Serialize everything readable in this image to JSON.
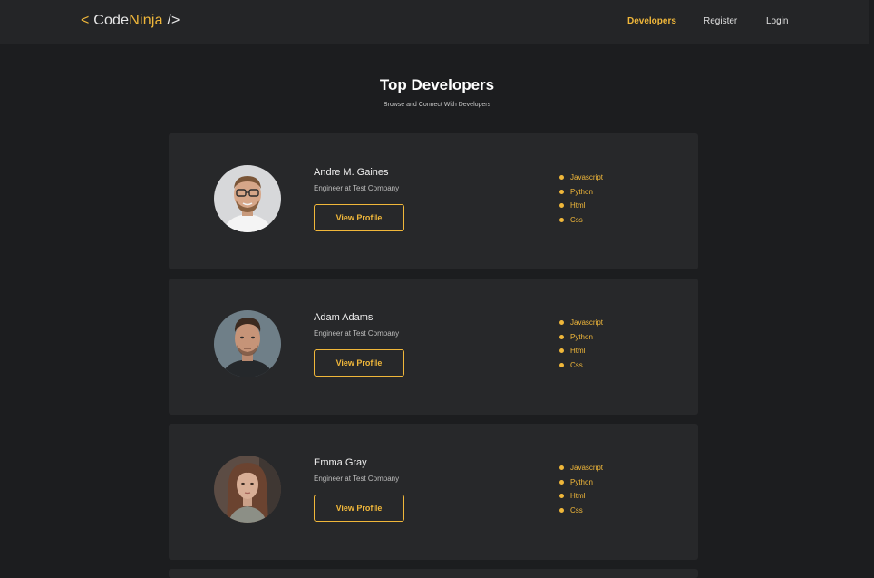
{
  "brand": {
    "open": "<",
    "name_part1": "Code",
    "name_part2": "Ninja",
    "close": "/>"
  },
  "nav": {
    "developers": "Developers",
    "register": "Register",
    "login": "Login",
    "active": "Developers"
  },
  "hero": {
    "title": "Top Developers",
    "subtitle": "Browse and Connect With Developers"
  },
  "developers": [
    {
      "name": "Andre M. Gaines",
      "role": "Engineer at Test Company",
      "button": "View Profile",
      "skills": [
        "Javascript",
        "Python",
        "Html",
        "Css"
      ]
    },
    {
      "name": "Adam Adams",
      "role": "Engineer at Test Company",
      "button": "View Profile",
      "skills": [
        "Javascript",
        "Python",
        "Html",
        "Css"
      ]
    },
    {
      "name": "Emma Gray",
      "role": "Engineer at Test Company",
      "button": "View Profile",
      "skills": [
        "Javascript",
        "Python",
        "Html",
        "Css"
      ]
    }
  ],
  "colors": {
    "accent": "#f0b73a",
    "background": "#1c1d1f",
    "card": "#27282a",
    "navbar": "#242527"
  }
}
